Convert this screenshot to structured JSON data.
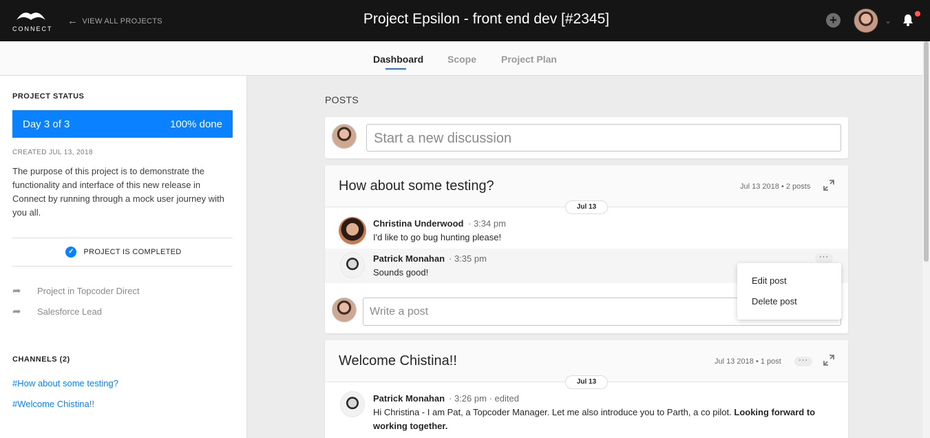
{
  "header": {
    "logo_text": "CONNECT",
    "back_label": "VIEW ALL PROJECTS",
    "title": "Project Epsilon - front end dev [#2345]"
  },
  "tabs": [
    {
      "label": "Dashboard",
      "active": true
    },
    {
      "label": "Scope",
      "active": false
    },
    {
      "label": "Project Plan",
      "active": false
    }
  ],
  "sidebar": {
    "status_heading": "PROJECT STATUS",
    "status_day": "Day 3 of 3",
    "status_done": "100% done",
    "progress_fraction": 1.0,
    "created": "CREATED JUL 13, 2018",
    "description": "The purpose of this project is to demonstrate the functionality and interface of this new release in Connect by running through a mock user journey with you all.",
    "completed_label": "PROJECT IS COMPLETED",
    "links": [
      "Project in Topcoder Direct",
      "Salesforce Lead"
    ],
    "channels_heading": "CHANNELS (2)",
    "channels": [
      "#How about some testing?",
      "#Welcome Chistina!!"
    ]
  },
  "main": {
    "posts_heading": "POSTS",
    "new_discussion_placeholder": "Start a new discussion",
    "threads": [
      {
        "title": "How about some testing?",
        "meta_date": "Jul 13 2018",
        "meta_count": "2 posts",
        "date_pill": "Jul 13",
        "posts": [
          {
            "author": "Christina Underwood",
            "time": "3:34 pm",
            "text": "I'd like to go bug hunting please!"
          },
          {
            "author": "Patrick Monahan",
            "time": "3:35 pm",
            "text": "Sounds good!"
          }
        ],
        "reply_placeholder": "Write a post"
      },
      {
        "title": "Welcome Chistina!!",
        "meta_date": "Jul 13 2018",
        "meta_count": "1 post",
        "date_pill": "Jul 13",
        "posts": [
          {
            "author": "Patrick Monahan",
            "time": "3:26 pm",
            "edited": "edited",
            "text_plain": "Hi Christina - I am Pat, a Topcoder Manager. Let me also introduce you to Parth, a co pilot. ",
            "text_bold": "Looking forward to working together."
          }
        ]
      }
    ],
    "post_menu": [
      "Edit post",
      "Delete post"
    ]
  },
  "colors": {
    "accent": "#0a81ff",
    "topbar": "#151516",
    "notification": "#ff5a52"
  },
  "icons": [
    "connect-logo-icon",
    "arrow-left-icon",
    "plus-icon",
    "chevron-down-icon",
    "bell-icon",
    "check-icon",
    "share-icon",
    "expand-icon",
    "more-icon"
  ]
}
